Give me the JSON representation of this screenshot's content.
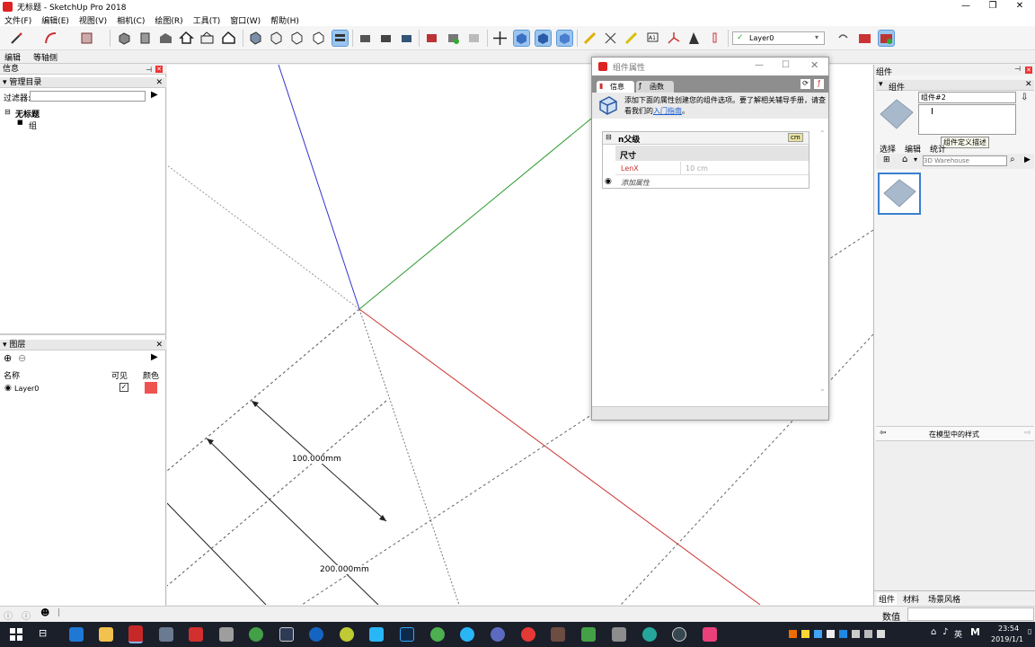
{
  "window": {
    "title": "无标题 - SketchUp Pro 2018"
  },
  "menu": [
    "文件(F)",
    "编辑(E)",
    "视图(V)",
    "相机(C)",
    "绘图(R)",
    "工具(T)",
    "窗口(W)",
    "帮助(H)"
  ],
  "toolbar": {
    "layer_value": "Layer0"
  },
  "scene_tabs": [
    "编辑",
    "等轴侧"
  ],
  "left": {
    "info_title": "信息",
    "outliner_title": "管理目录",
    "filter_label": "过滤器:",
    "tree_root": "无标题",
    "tree_child": "组",
    "layers_title": "图层",
    "col_name": "名称",
    "col_visible": "可见",
    "col_color": "颜色",
    "layer_name": "Layer0",
    "layer_color": "#ef5350"
  },
  "dimensions": {
    "d1": "100.000mm",
    "d2": "200.000mm"
  },
  "dialog": {
    "title": "组件属性",
    "tab_info": "信息",
    "tab_func": "函数",
    "help_text": "添加下面的属性创建您的组件选项。要了解相关辅导手册，请查看我们的",
    "help_link": "入门指南",
    "help_end": "。",
    "group_name": "n父级",
    "unit_badge": "cm",
    "section": "尺寸",
    "attr_name": "LenX",
    "attr_value": "10 cm",
    "add_attr": "添加属性"
  },
  "right": {
    "panel_title": "组件",
    "sub_title": "组件",
    "comp_name": "组件#2",
    "tab_select": "选择",
    "tab_edit": "编辑",
    "tab_stats": "统计",
    "tooltip": "组件定义描述",
    "search_placeholder": "3D Warehouse",
    "styles_label": "在模型中的样式",
    "bottom_tabs": [
      "组件",
      "材料",
      "场景风格"
    ],
    "value_label": "数值"
  },
  "taskbar": {
    "time": "23:54",
    "date": "2019/1/1",
    "ime": "英"
  }
}
